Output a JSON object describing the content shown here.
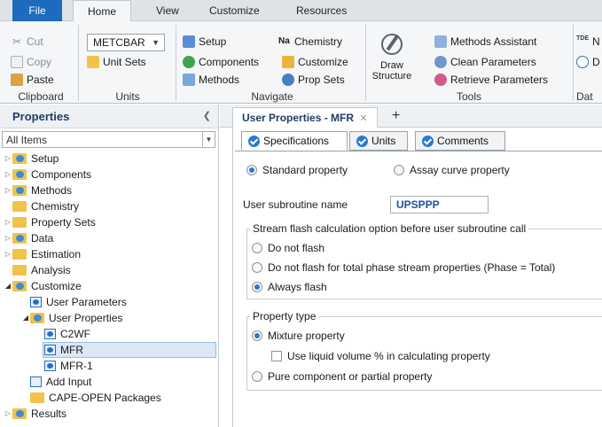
{
  "ribbon": {
    "tabs": [
      "File",
      "Home",
      "View",
      "Customize",
      "Resources"
    ],
    "clipboard": {
      "cut": "Cut",
      "copy": "Copy",
      "paste": "Paste",
      "label": "Clipboard"
    },
    "units": {
      "selected": "METCBAR",
      "unit_sets": "Unit Sets",
      "label": "Units"
    },
    "navigate": {
      "setup": "Setup",
      "components": "Components",
      "methods": "Methods",
      "chemistry": "Chemistry",
      "customize": "Customize",
      "prop_sets": "Prop Sets",
      "label": "Navigate"
    },
    "tools": {
      "draw_structure_1": "Draw",
      "draw_structure_2": "Structure",
      "methods_assistant": "Methods Assistant",
      "clean_parameters": "Clean Parameters",
      "retrieve_parameters": "Retrieve Parameters",
      "label": "Tools"
    },
    "data": {
      "item1": "N",
      "item2": "D",
      "label": "Dat"
    }
  },
  "left_pane": {
    "title": "Properties",
    "filter": "All Items",
    "tree": [
      {
        "label": "Setup"
      },
      {
        "label": "Components"
      },
      {
        "label": "Methods"
      },
      {
        "label": "Chemistry"
      },
      {
        "label": "Property Sets"
      },
      {
        "label": "Data"
      },
      {
        "label": "Estimation"
      },
      {
        "label": "Analysis"
      },
      {
        "label": "Customize"
      },
      {
        "label": "User Parameters"
      },
      {
        "label": "User Properties"
      },
      {
        "label": "C2WF"
      },
      {
        "label": "MFR"
      },
      {
        "label": "MFR-1"
      },
      {
        "label": "Add Input"
      },
      {
        "label": "CAPE-OPEN Packages"
      },
      {
        "label": "Results"
      }
    ]
  },
  "document": {
    "tab_title": "User Properties - MFR",
    "inner_tabs": [
      "Specifications",
      "Units",
      "Comments"
    ],
    "property_choice": {
      "standard": "Standard property",
      "assay": "Assay curve property"
    },
    "subroutine": {
      "label": "User subroutine name",
      "value": "UPSPPP"
    },
    "flash": {
      "legend": "Stream flash calculation option before user subroutine call",
      "options": [
        "Do not flash",
        "Do not flash for total phase stream properties (Phase = Total)",
        "Always flash"
      ]
    },
    "property_type": {
      "legend": "Property type",
      "mixture": "Mixture property",
      "liquid_volume": "Use liquid volume % in calculating property",
      "pure": "Pure component or partial property"
    }
  }
}
